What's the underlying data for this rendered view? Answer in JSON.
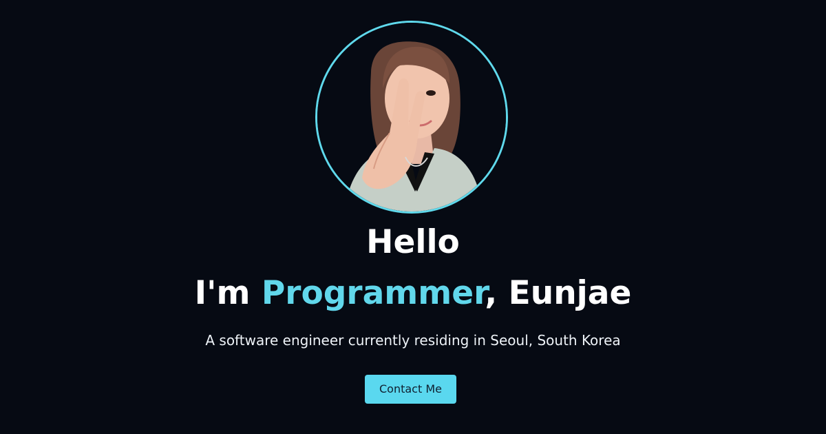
{
  "theme": {
    "background": "#060a13",
    "accent": "#61d7eb",
    "text": "#ffffff",
    "button_background": "#5ad8ef",
    "button_text": "#102030"
  },
  "avatar": {
    "alt": "Portrait photo of Eunjae"
  },
  "hero": {
    "greeting": "Hello",
    "intro_prefix": "I'm ",
    "intro_role": "Programmer",
    "intro_suffix": ", Eunjae",
    "tagline": "A software engineer currently residing in Seoul, South Korea",
    "contact_button_label": "Contact Me"
  }
}
